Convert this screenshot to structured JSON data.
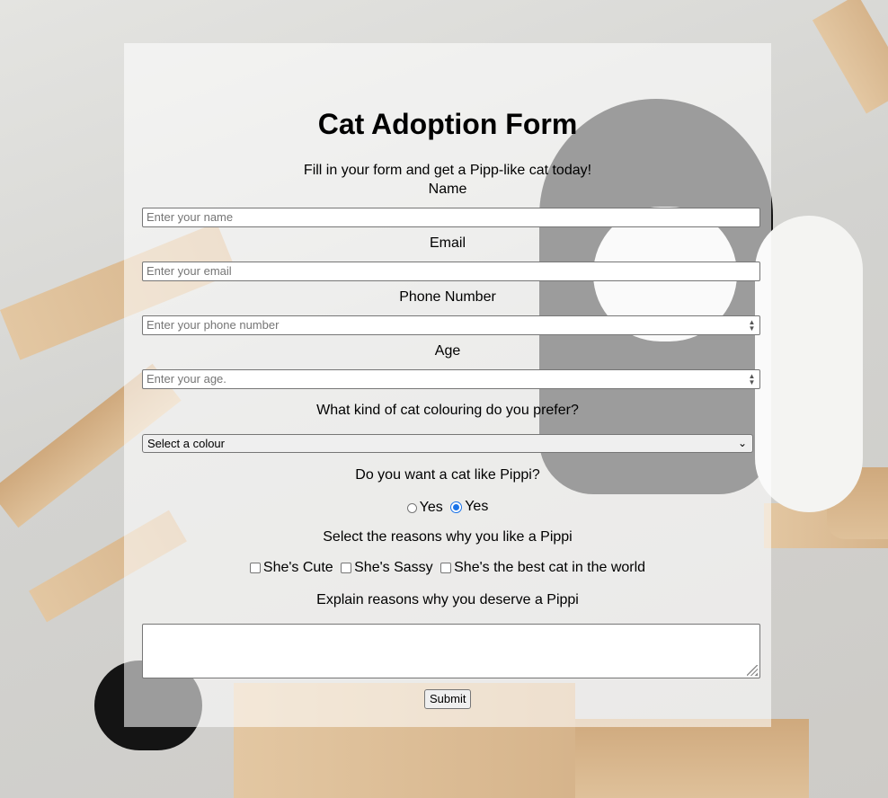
{
  "form": {
    "title": "Cat Adoption Form",
    "subtitle": "Fill in your form and get a Pipp-like cat today!",
    "name_label": "Name",
    "name_placeholder": "Enter your name",
    "email_label": "Email",
    "email_placeholder": "Enter your email",
    "phone_label": "Phone Number",
    "phone_placeholder": "Enter your phone number",
    "age_label": "Age",
    "age_placeholder": "Enter your age.",
    "colour_label": "What kind of cat colouring do you prefer?",
    "colour_selected": "Select a colour",
    "pippi_question": "Do you want a cat like Pippi?",
    "pippi_options": [
      {
        "label": "Yes",
        "checked": false
      },
      {
        "label": "Yes",
        "checked": true
      }
    ],
    "reasons_label": "Select the reasons why you like a Pippi",
    "reasons": [
      {
        "label": "She's Cute",
        "checked": false
      },
      {
        "label": "She's Sassy",
        "checked": false
      },
      {
        "label": "She's the best cat in the world",
        "checked": false
      }
    ],
    "explain_label": "Explain reasons why you deserve a Pippi",
    "submit_label": "Submit"
  },
  "colors": {
    "radio_checked": "#1a73e8"
  }
}
